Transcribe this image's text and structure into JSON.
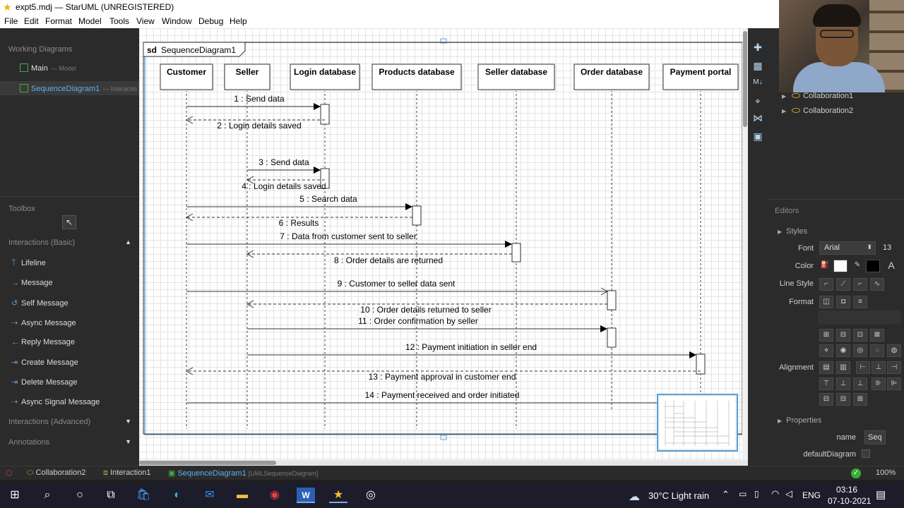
{
  "window": {
    "title": "expt5.mdj — StarUML (UNREGISTERED)"
  },
  "menu": [
    "File",
    "Edit",
    "Format",
    "Model",
    "Tools",
    "View",
    "Window",
    "Debug",
    "Help"
  ],
  "working_diagrams": {
    "header": "Working Diagrams",
    "items": [
      {
        "label": "Main",
        "sub": "— Model"
      },
      {
        "label": "SequenceDiagram1",
        "sub": "— Interactio"
      }
    ]
  },
  "toolbox": {
    "header": "Toolbox",
    "groups": [
      {
        "label": "Interactions (Basic)",
        "items": [
          "Lifeline",
          "Message",
          "Self Message",
          "Async Message",
          "Reply Message",
          "Create Message",
          "Delete Message",
          "Async Signal Message"
        ]
      },
      {
        "label": "Interactions (Advanced)"
      },
      {
        "label": "Annotations"
      }
    ]
  },
  "diagram": {
    "frame_label": "sd",
    "name": "SequenceDiagram1",
    "lifelines": [
      "Customer",
      "Seller",
      "Login database",
      "Products database",
      "Seller database",
      "Order database",
      "Payment portal"
    ],
    "messages": [
      {
        "label": "1 : Send data",
        "from": 0,
        "to": 2,
        "kind": "sync"
      },
      {
        "label": "2 : Login details saved",
        "from": 2,
        "to": 0,
        "kind": "reply"
      },
      {
        "label": "3 : Send data",
        "from": 1,
        "to": 2,
        "kind": "sync"
      },
      {
        "label": "4 : Login details saved",
        "from": 2,
        "to": 1,
        "kind": "reply"
      },
      {
        "label": "5 : Search data",
        "from": 0,
        "to": 3,
        "kind": "sync"
      },
      {
        "label": "6 : Results",
        "from": 3,
        "to": 0,
        "kind": "reply"
      },
      {
        "label": "7 : Data from customer sent to seller",
        "from": 0,
        "to": 4,
        "kind": "sync"
      },
      {
        "label": "8 : Order details are returned",
        "from": 4,
        "to": 1,
        "kind": "reply"
      },
      {
        "label": "9 : Customer to seller data sent",
        "from": 0,
        "to": 5,
        "kind": "async"
      },
      {
        "label": "10 : Order details returned to seller",
        "from": 5,
        "to": 1,
        "kind": "reply"
      },
      {
        "label": "11 : Order confirmation by seller",
        "from": 1,
        "to": 5,
        "kind": "sync"
      },
      {
        "label": "12 : Payment initiation in seller end",
        "from": 1,
        "to": 6,
        "kind": "sync"
      },
      {
        "label": "13 : Payment approval in customer end",
        "from": 6,
        "to": 0,
        "kind": "reply"
      },
      {
        "label": "14 : Payment received and order initiated",
        "from": 0,
        "to": 6,
        "kind": "sync"
      }
    ]
  },
  "model_tree": [
    "Collaboration1",
    "Collaboration2"
  ],
  "editors": {
    "header": "Editors",
    "styles": "Styles",
    "font_label": "Font",
    "font_name": "Arial",
    "font_size": "13",
    "color_label": "Color",
    "line_style_label": "Line Style",
    "format_label": "Format",
    "alignment_label": "Alignment",
    "properties": "Properties",
    "name_label": "name",
    "name_value": "Seq",
    "default_diagram_label": "defaultDiagram"
  },
  "statusbar": {
    "items": [
      {
        "label": "Collaboration2",
        "sub": ""
      },
      {
        "label": "Interaction1",
        "sub": ""
      },
      {
        "label": "SequenceDiagram1",
        "sub": "[UMLSequenceDiagram]"
      }
    ],
    "zoom": "100%"
  },
  "taskbar": {
    "weather": "30°C  Light rain",
    "lang": "ENG",
    "time": "03:16",
    "date": "07-10-2021"
  },
  "colors": {
    "accent": "#5a9fd4",
    "green": "#3aa83a",
    "panel": "#2b2b2b"
  }
}
